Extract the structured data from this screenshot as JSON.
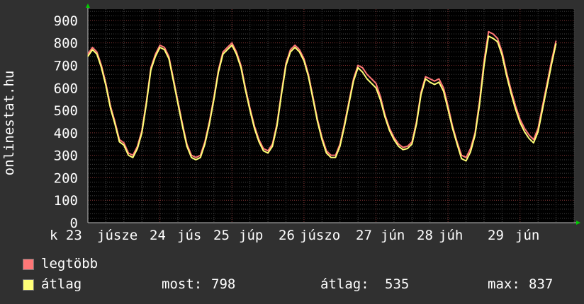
{
  "chart_data": {
    "type": "line",
    "ylabel": "onlinestat.hu",
    "ylim": [
      0,
      950
    ],
    "yticks": [
      "0",
      "100",
      "200",
      "300",
      "400",
      "500",
      "600",
      "700",
      "800",
      "900"
    ],
    "xticks": [
      "k 23",
      "júsze",
      "24",
      "jús",
      "25",
      "júp",
      "26",
      "júszo",
      "27",
      "jún",
      "28",
      "júh",
      "29",
      "jún"
    ],
    "x": [
      0,
      0.25,
      0.5,
      0.75,
      1,
      1.25,
      1.5,
      1.75,
      2,
      2.25,
      2.5,
      2.75,
      3,
      3.25,
      3.5,
      3.75,
      4,
      4.25,
      4.5,
      4.75,
      5,
      5.25,
      5.5,
      5.75,
      6,
      6.25,
      6.5,
      6.75,
      7,
      7.25,
      7.5,
      7.75,
      8,
      8.25,
      8.5,
      8.75,
      9,
      9.25,
      9.5,
      9.75,
      10,
      10.25,
      10.5,
      10.75,
      11,
      11.25,
      11.5,
      11.75,
      12,
      12.25,
      12.5,
      12.75,
      13,
      13.25,
      13.5,
      13.75,
      14,
      14.25,
      14.5,
      14.75,
      15,
      15.25,
      15.5,
      15.75,
      16,
      16.25,
      16.5,
      16.75,
      17,
      17.25,
      17.5,
      17.75,
      18,
      18.25,
      18.5,
      18.75,
      19,
      19.25,
      19.5,
      19.75,
      20,
      20.25,
      20.5,
      20.75,
      21,
      21.25,
      21.5,
      21.75,
      22,
      22.25,
      22.5,
      22.75,
      23,
      23.25,
      23.5,
      23.75,
      24,
      24.25,
      24.5,
      24.75,
      25,
      25.25,
      25.5,
      25.75,
      26,
      26.25,
      26.5,
      26.75,
      27
    ],
    "series": [
      {
        "name": "legtöbb",
        "color": "#ff7777",
        "values": [
          750,
          780,
          760,
          700,
          620,
          520,
          450,
          370,
          355,
          310,
          300,
          340,
          410,
          540,
          690,
          750,
          790,
          780,
          740,
          640,
          540,
          440,
          350,
          300,
          290,
          300,
          360,
          450,
          560,
          680,
          760,
          780,
          800,
          760,
          700,
          600,
          510,
          430,
          370,
          330,
          320,
          350,
          440,
          580,
          710,
          770,
          790,
          770,
          730,
          660,
          560,
          460,
          380,
          320,
          300,
          300,
          350,
          440,
          540,
          640,
          700,
          690,
          660,
          640,
          620,
          560,
          480,
          420,
          380,
          350,
          335,
          340,
          360,
          450,
          580,
          650,
          640,
          630,
          640,
          600,
          520,
          430,
          360,
          300,
          290,
          330,
          400,
          540,
          720,
          850,
          840,
          820,
          760,
          670,
          590,
          520,
          460,
          420,
          390,
          370,
          420,
          520,
          620,
          720,
          810
        ]
      },
      {
        "name": "átlag",
        "color": "#ffff77",
        "values": [
          740,
          770,
          750,
          690,
          610,
          510,
          440,
          360,
          345,
          300,
          290,
          330,
          400,
          530,
          680,
          740,
          780,
          770,
          730,
          630,
          530,
          430,
          340,
          290,
          280,
          290,
          350,
          440,
          550,
          670,
          750,
          770,
          790,
          750,
          690,
          590,
          500,
          420,
          360,
          320,
          310,
          340,
          430,
          570,
          700,
          760,
          780,
          760,
          720,
          650,
          550,
          450,
          370,
          310,
          290,
          290,
          340,
          430,
          530,
          630,
          690,
          670,
          640,
          620,
          600,
          545,
          470,
          410,
          370,
          340,
          325,
          330,
          350,
          440,
          570,
          640,
          625,
          615,
          625,
          585,
          505,
          420,
          350,
          285,
          275,
          315,
          390,
          525,
          700,
          830,
          820,
          805,
          745,
          655,
          575,
          505,
          445,
          405,
          375,
          355,
          405,
          505,
          605,
          705,
          798
        ]
      }
    ],
    "legend": [
      "legtöbb",
      "átlag"
    ],
    "grid": true,
    "stats": {
      "most_label": "most:",
      "most": "798",
      "avg_label": "átlag:",
      "avg": "535",
      "max_label": "max:",
      "max": "837"
    },
    "colors": {
      "background": "#303030",
      "plot": "#000000",
      "grid_minor": "#444444",
      "grid_major": "#7a2a2a",
      "axis": "#bbbbbb",
      "arrow": "#00cc00"
    }
  }
}
